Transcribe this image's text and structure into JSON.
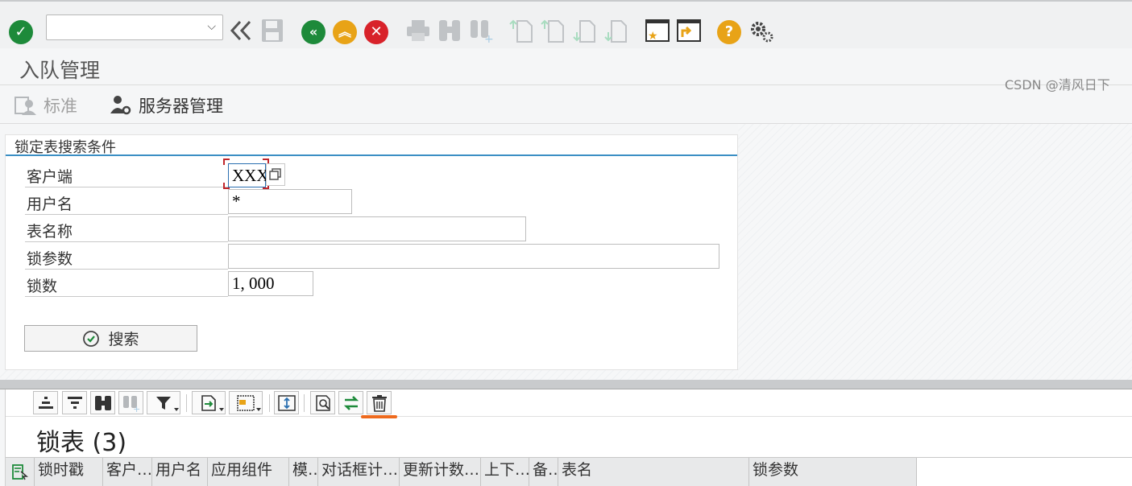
{
  "toolbar": {
    "command_field_value": "",
    "icons": [
      "enter-check-icon",
      "command-dropdown-icon",
      "collapse-icon",
      "save-icon",
      "back-icon",
      "exit-icon",
      "cancel-icon",
      "print-icon",
      "find-icon",
      "find-next-icon",
      "first-page-icon",
      "prev-page-icon",
      "next-page-icon",
      "last-page-icon",
      "create-session-icon",
      "shortcut-icon",
      "help-icon",
      "settings-icon"
    ]
  },
  "title": "入队管理",
  "app_toolbar": {
    "standard_label": "标准",
    "server_mgmt_label": "服务器管理"
  },
  "search_panel": {
    "title": "锁定表搜索条件",
    "fields": [
      {
        "label": "客户端",
        "value": "XXX"
      },
      {
        "label": "用户名",
        "value": "*"
      },
      {
        "label": "表名称",
        "value": ""
      },
      {
        "label": "锁参数",
        "value": ""
      },
      {
        "label": "锁数",
        "value": "1, 000"
      }
    ],
    "search_button_label": "搜索"
  },
  "results": {
    "title": "锁表 (3)",
    "columns": [
      "锁时戳",
      "客户…",
      "用户名",
      "应用组件",
      "模…",
      "对话框计…",
      "更新计数…",
      "上下…",
      "备…",
      "表名",
      "锁参数"
    ]
  },
  "watermark": "CSDN @清风日下",
  "colors": {
    "accent_blue": "#3b8fc4",
    "green": "#1d8a3a",
    "yellow": "#e8a317",
    "red": "#d8222a",
    "highlight_orange": "#ee6a1e"
  }
}
